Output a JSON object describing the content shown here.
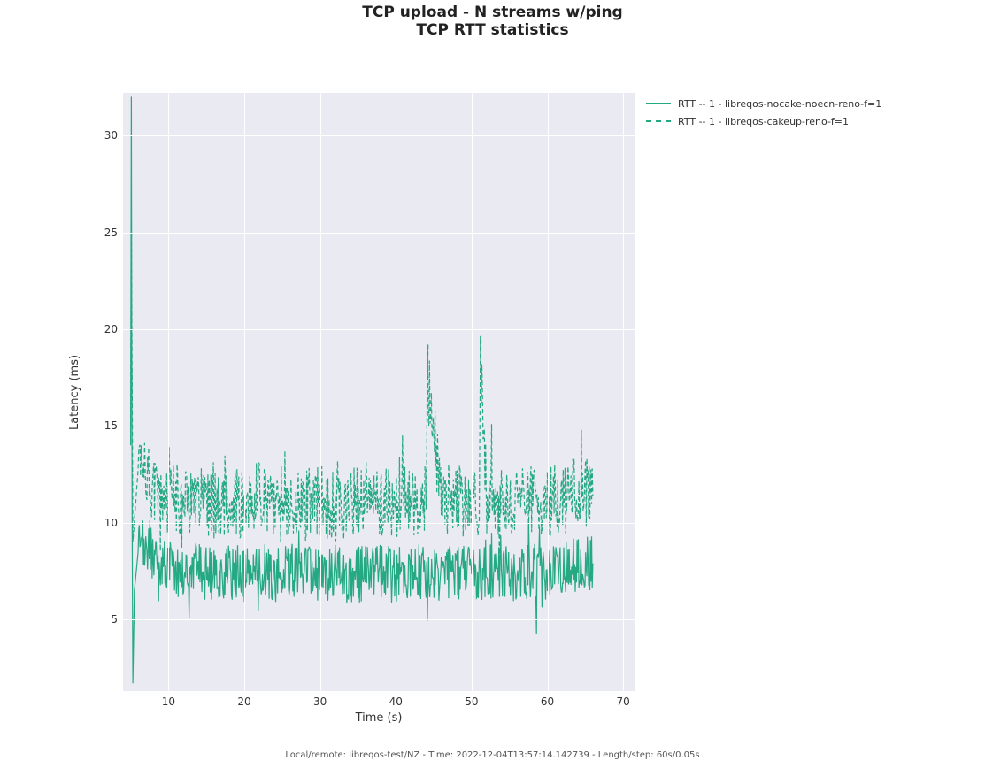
{
  "title_line1": "TCP upload - N streams w/ping",
  "title_line2": "TCP RTT statistics",
  "xlabel": "Time (s)",
  "ylabel": "Latency (ms)",
  "footer": "Local/remote: libreqos-test/NZ - Time: 2022-12-04T13:57:14.142739 - Length/step: 60s/0.05s",
  "legend": {
    "series1": "RTT -- 1 - libreqos-nocake-noecn-reno-f=1",
    "series2": "RTT -- 1 - libreqos-cakeup-reno-f=1"
  },
  "x_ticks": [
    10,
    20,
    30,
    40,
    50,
    60,
    70
  ],
  "y_ticks": [
    5,
    10,
    15,
    20,
    25,
    30
  ],
  "chart_data": {
    "type": "line",
    "xlabel": "Time (s)",
    "ylabel": "Latency (ms)",
    "xlim": [
      4,
      71.5
    ],
    "ylim": [
      1.3,
      32.2
    ],
    "title": "TCP upload - N streams w/ping — TCP RTT statistics",
    "series": [
      {
        "name": "RTT -- 1 - libreqos-nocake-noecn-reno-f=1",
        "style": "solid",
        "color": "#25a983",
        "note": "Dense noisy samples approx 5–66 s. Initial burst climbs to ~32 ms at ~5 s then drops below ~2 ms by ~5.3 s, then settles into a band roughly 6–9 ms with frequent sub-second jitter for the remainder.",
        "x": [
          5.0,
          5.05,
          5.1,
          5.15,
          5.2,
          5.3,
          5.5,
          6,
          7,
          8,
          9,
          10,
          12,
          14,
          16,
          18,
          20,
          22,
          24,
          26,
          28,
          30,
          32,
          34,
          36,
          38,
          40,
          42,
          44,
          46,
          48,
          50,
          52,
          54,
          56,
          58,
          60,
          62,
          64,
          66
        ],
        "y": [
          14,
          24,
          32,
          20,
          10,
          1.7,
          6.5,
          8.5,
          8.8,
          8.3,
          8.0,
          7.8,
          7.4,
          7.6,
          7.2,
          7.5,
          7.3,
          7.6,
          7.2,
          7.5,
          7.4,
          7.3,
          7.5,
          7.2,
          7.4,
          7.5,
          7.3,
          7.6,
          7.4,
          7.2,
          7.5,
          7.3,
          7.4,
          7.6,
          7.3,
          7.5,
          7.4,
          7.6,
          7.8,
          7.9
        ],
        "jitter_band_ms": [
          5.8,
          9.2
        ]
      },
      {
        "name": "RTT -- 1 - libreqos-cakeup-reno-f=1",
        "style": "dashed",
        "color": "#25a983",
        "note": "Dense noisy samples approx 5–66 s. Starts high with the same initial burst, then settles into a band roughly 9–13 ms with occasional spikes to ~14 ms; isolated spikes near t≈44 s (~17.4 ms) and t≈51 s (~17.8 ms).",
        "x": [
          5.0,
          5.1,
          5.3,
          6,
          7,
          8,
          9,
          10,
          12,
          14,
          16,
          18,
          20,
          22,
          24,
          26,
          28,
          30,
          32,
          34,
          36,
          38,
          40,
          42,
          44,
          44.2,
          46,
          48,
          50,
          51,
          51.2,
          52,
          54,
          56,
          58,
          60,
          62,
          64,
          66
        ],
        "y": [
          15,
          26,
          9,
          12.8,
          12.3,
          11.8,
          11.0,
          11.4,
          11.0,
          11.4,
          10.8,
          11.2,
          10.9,
          11.3,
          10.8,
          11.1,
          10.9,
          11.2,
          10.8,
          11.0,
          11.3,
          10.9,
          11.2,
          11.0,
          11.1,
          17.4,
          11.0,
          11.2,
          10.9,
          11.1,
          17.8,
          11.0,
          11.2,
          10.9,
          11.1,
          11.0,
          11.3,
          11.6,
          11.4
        ],
        "jitter_band_ms": [
          8.8,
          13.2
        ]
      }
    ]
  }
}
